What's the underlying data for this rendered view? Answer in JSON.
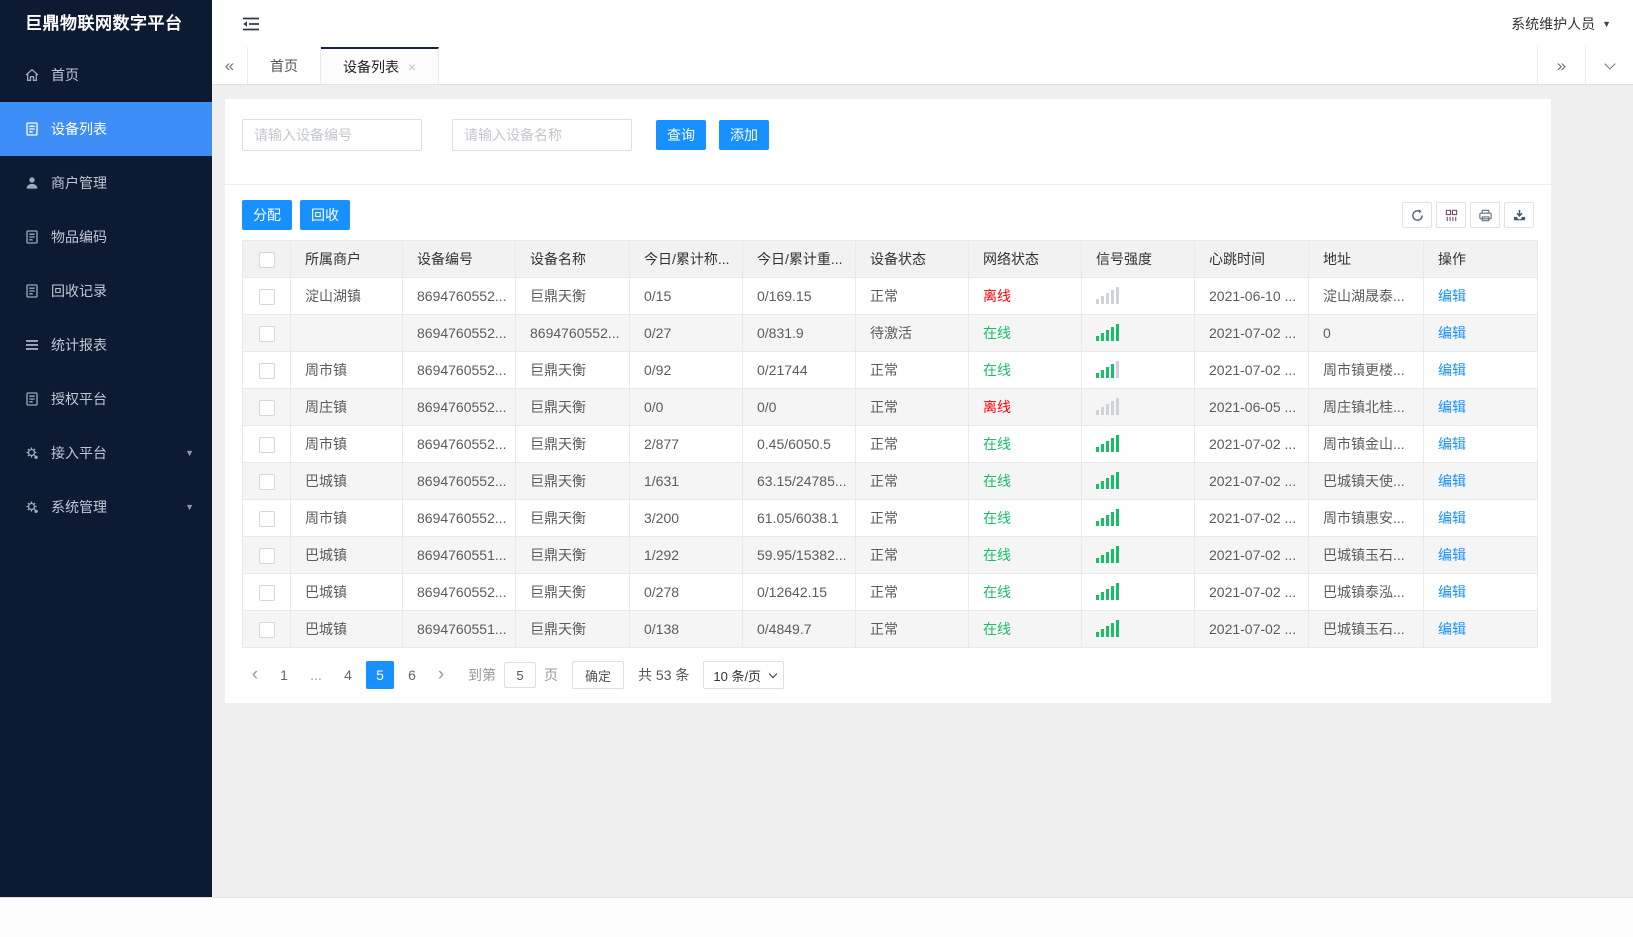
{
  "app": {
    "title": "巨鼎物联网数字平台",
    "user_label": "系统维护人员"
  },
  "sidebar": {
    "items": [
      {
        "icon": "home-icon",
        "label": "首页",
        "active": false
      },
      {
        "icon": "device-list-icon",
        "label": "设备列表",
        "active": true
      },
      {
        "icon": "merchant-icon",
        "label": "商户管理",
        "active": false
      },
      {
        "icon": "item-code-icon",
        "label": "物品编码",
        "active": false
      },
      {
        "icon": "recycle-record-icon",
        "label": "回收记录",
        "active": false
      },
      {
        "icon": "report-icon",
        "label": "统计报表",
        "active": false
      },
      {
        "icon": "authorize-icon",
        "label": "授权平台",
        "active": false
      },
      {
        "icon": "gear-icon",
        "label": "接入平台",
        "active": false,
        "caret": true
      },
      {
        "icon": "gear-icon",
        "label": "系统管理",
        "active": false,
        "caret": true
      }
    ]
  },
  "tabs": {
    "items": [
      {
        "label": "首页",
        "active": false,
        "closable": false
      },
      {
        "label": "设备列表",
        "active": true,
        "closable": true
      }
    ]
  },
  "search": {
    "device_no_placeholder": "请输入设备编号",
    "device_name_placeholder": "请输入设备名称",
    "query_label": "查询",
    "add_label": "添加"
  },
  "table_toolbar": {
    "assign_label": "分配",
    "recycle_label": "回收",
    "icons": [
      "refresh-icon",
      "columns-icon",
      "print-icon",
      "export-icon"
    ]
  },
  "table": {
    "columns": [
      "所属商户",
      "设备编号",
      "设备名称",
      "今日/累计称...",
      "今日/累计重...",
      "设备状态",
      "网络状态",
      "信号强度",
      "心跳时间",
      "地址",
      "操作"
    ],
    "rows": [
      {
        "merchant": "淀山湖镇",
        "device_no": "8694760552...",
        "device_name": "巨鼎天衡",
        "today_count": "0/15",
        "today_weight": "0/169.15",
        "device_status": "正常",
        "network_status": "离线",
        "network_online": false,
        "signal": 0,
        "heartbeat": "2021-06-10 ...",
        "address": "淀山湖晟泰...",
        "action": "编辑"
      },
      {
        "merchant": "",
        "device_no": "8694760552...",
        "device_name": "8694760552...",
        "today_count": "0/27",
        "today_weight": "0/831.9",
        "device_status": "待激活",
        "network_status": "在线",
        "network_online": true,
        "signal": 5,
        "heartbeat": "2021-07-02 ...",
        "address": "0",
        "action": "编辑"
      },
      {
        "merchant": "周市镇",
        "device_no": "8694760552...",
        "device_name": "巨鼎天衡",
        "today_count": "0/92",
        "today_weight": "0/21744",
        "device_status": "正常",
        "network_status": "在线",
        "network_online": true,
        "signal": 4,
        "heartbeat": "2021-07-02 ...",
        "address": "周市镇更楼...",
        "action": "编辑"
      },
      {
        "merchant": "周庄镇",
        "device_no": "8694760552...",
        "device_name": "巨鼎天衡",
        "today_count": "0/0",
        "today_weight": "0/0",
        "device_status": "正常",
        "network_status": "离线",
        "network_online": false,
        "signal": 0,
        "heartbeat": "2021-06-05 ...",
        "address": "周庄镇北桂...",
        "action": "编辑"
      },
      {
        "merchant": "周市镇",
        "device_no": "8694760552...",
        "device_name": "巨鼎天衡",
        "today_count": "2/877",
        "today_weight": "0.45/6050.5",
        "device_status": "正常",
        "network_status": "在线",
        "network_online": true,
        "signal": 5,
        "heartbeat": "2021-07-02 ...",
        "address": "周市镇金山...",
        "action": "编辑"
      },
      {
        "merchant": "巴城镇",
        "device_no": "8694760552...",
        "device_name": "巨鼎天衡",
        "today_count": "1/631",
        "today_weight": "63.15/24785...",
        "device_status": "正常",
        "network_status": "在线",
        "network_online": true,
        "signal": 5,
        "heartbeat": "2021-07-02 ...",
        "address": "巴城镇天使...",
        "action": "编辑"
      },
      {
        "merchant": "周市镇",
        "device_no": "8694760552...",
        "device_name": "巨鼎天衡",
        "today_count": "3/200",
        "today_weight": "61.05/6038.1",
        "device_status": "正常",
        "network_status": "在线",
        "network_online": true,
        "signal": 5,
        "heartbeat": "2021-07-02 ...",
        "address": "周市镇惠安...",
        "action": "编辑"
      },
      {
        "merchant": "巴城镇",
        "device_no": "8694760551...",
        "device_name": "巨鼎天衡",
        "today_count": "1/292",
        "today_weight": "59.95/15382...",
        "device_status": "正常",
        "network_status": "在线",
        "network_online": true,
        "signal": 5,
        "heartbeat": "2021-07-02 ...",
        "address": "巴城镇玉石...",
        "action": "编辑"
      },
      {
        "merchant": "巴城镇",
        "device_no": "8694760552...",
        "device_name": "巨鼎天衡",
        "today_count": "0/278",
        "today_weight": "0/12642.15",
        "device_status": "正常",
        "network_status": "在线",
        "network_online": true,
        "signal": 5,
        "heartbeat": "2021-07-02 ...",
        "address": "巴城镇泰泓...",
        "action": "编辑"
      },
      {
        "merchant": "巴城镇",
        "device_no": "8694760551...",
        "device_name": "巨鼎天衡",
        "today_count": "0/138",
        "today_weight": "0/4849.7",
        "device_status": "正常",
        "network_status": "在线",
        "network_online": true,
        "signal": 5,
        "heartbeat": "2021-07-02 ...",
        "address": "巴城镇玉石...",
        "action": "编辑"
      }
    ]
  },
  "pagination": {
    "pages": [
      "1",
      "...",
      "4",
      "5",
      "6"
    ],
    "active": "5",
    "goto_label": "到第",
    "goto_value": "5",
    "unit_label": "页",
    "confirm_label": "确定",
    "total_label": "共 53 条",
    "page_size_label": "10 条/页"
  },
  "colors": {
    "primary": "#1890ff",
    "sidebar_bg": "#0c1a32",
    "sidebar_active": "#3e8ef7",
    "online": "#19be6b",
    "offline": "#ff0000"
  }
}
